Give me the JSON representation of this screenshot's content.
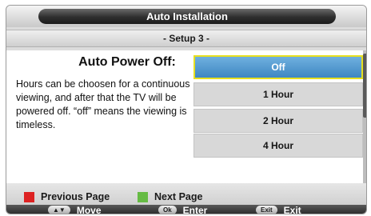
{
  "title": "Auto Installation",
  "subtitle": "- Setup 3 -",
  "heading": "Auto Power Off:",
  "description": "Hours can be choosen for a continuous viewing, and after that the TV will be powered off. “off” means the viewing is timeless.",
  "options": [
    {
      "label": "Off",
      "selected": true
    },
    {
      "label": "1 Hour",
      "selected": false
    },
    {
      "label": "2 Hour",
      "selected": false
    },
    {
      "label": "4 Hour",
      "selected": false
    }
  ],
  "color_keys": [
    {
      "label": "Previous Page",
      "color": "#dd2222"
    },
    {
      "label": "Next Page",
      "color": "#66bb44"
    }
  ],
  "nav": [
    {
      "key": "▲▼",
      "label": "Move",
      "icon": "updown-arrows-icon"
    },
    {
      "key": "Ok",
      "label": "Enter",
      "icon": "ok-key-icon"
    },
    {
      "key": "Exit",
      "label": "Exit",
      "icon": "exit-key-icon"
    }
  ],
  "colors": {
    "selected_fill": "#4a90c8",
    "selected_border": "#e8e020",
    "option_fill": "#d8d8d8"
  }
}
